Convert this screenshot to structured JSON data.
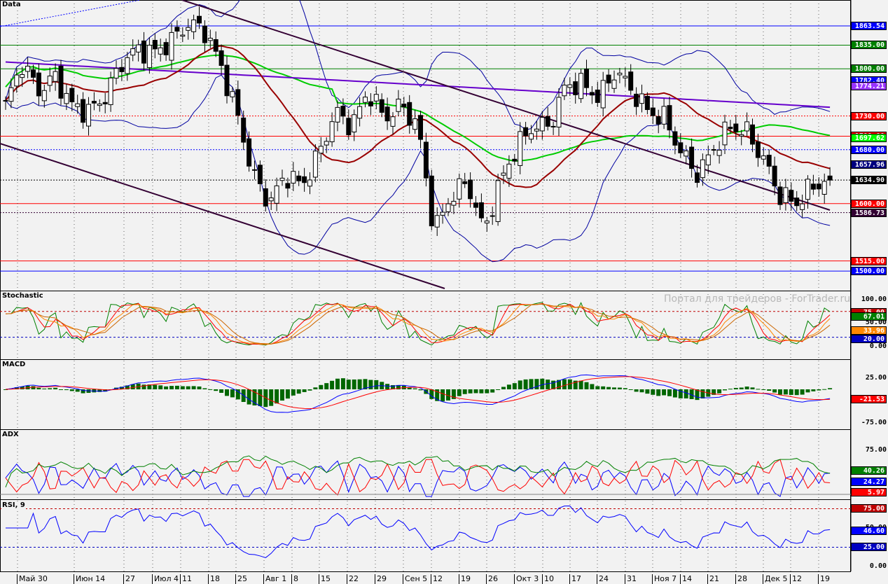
{
  "panels": {
    "main": "Data",
    "stoch": "Stochastic",
    "macd": "MACD",
    "adx": "ADX",
    "rsi": "RSI, 9"
  },
  "watermark": "Портал для трейдеров - ForTrader.ru",
  "price_tags": [
    {
      "label": "1863.54",
      "value": 1863.54,
      "color": "#0000ff",
      "line": "solid"
    },
    {
      "label": "1835.00",
      "value": 1835,
      "color": "#008000",
      "line": "solid"
    },
    {
      "label": "1800.00",
      "value": 1800,
      "color": "#008000",
      "line": "solid"
    },
    {
      "label": "1782.40",
      "value": 1782.4,
      "color": "#0000ff",
      "line": "none"
    },
    {
      "label": "1774.21",
      "value": 1774.21,
      "color": "#9933ff",
      "line": "none"
    },
    {
      "label": "1730.00",
      "value": 1730,
      "color": "#ff0000",
      "line": "dotted"
    },
    {
      "label": "1700.00",
      "value": 1700,
      "color": "#ff0000",
      "line": "solid"
    },
    {
      "label": "1697.62",
      "value": 1697.62,
      "color": "#00ff00",
      "line": "none"
    },
    {
      "label": "1680.00",
      "value": 1680,
      "color": "#0000ff",
      "line": "dotted"
    },
    {
      "label": "1657.96",
      "value": 1657.96,
      "color": "#000080",
      "line": "none"
    },
    {
      "label": "1634.90",
      "value": 1634.9,
      "color": "#000000",
      "line": "dotted"
    },
    {
      "label": "1600.00",
      "value": 1600,
      "color": "#ff0000",
      "line": "solid"
    },
    {
      "label": "1586.73",
      "value": 1586.73,
      "color": "#330033",
      "line": "dotted"
    },
    {
      "label": "1515.00",
      "value": 1515,
      "color": "#ff0000",
      "line": "solid"
    },
    {
      "label": "1500.00",
      "value": 1500,
      "color": "#0000ff",
      "line": "solid"
    }
  ],
  "indicator_axes": {
    "stoch": [
      "100.00",
      "50.00",
      "0.00"
    ],
    "macd": [
      "25.00",
      "-75.00"
    ],
    "adx": [
      "75.00"
    ],
    "rsi": [
      "50.00",
      "0.00"
    ]
  },
  "indicator_tags": {
    "stoch": [
      {
        "label": "75.00",
        "color": "#c00000"
      },
      {
        "label": "67.01",
        "color": "#008000"
      },
      {
        "label": "33.96",
        "color": "#ff8800"
      },
      {
        "label": "20.00",
        "color": "#0000c0"
      }
    ],
    "macd": [
      {
        "label": "-21.53",
        "color": "#ff0000"
      }
    ],
    "adx": [
      {
        "label": "40.26",
        "color": "#008000"
      },
      {
        "label": "24.27",
        "color": "#0000ff"
      },
      {
        "label": "5.97",
        "color": "#ff0000"
      }
    ],
    "rsi": [
      {
        "label": "75.00",
        "color": "#c00000"
      },
      {
        "label": "46.60",
        "color": "#0000ff"
      },
      {
        "label": "25.00",
        "color": "#0000c0"
      }
    ]
  },
  "dates": [
    "Май 30",
    "Июн 14",
    "27",
    "Июл 4",
    "11",
    "18",
    "25",
    "Авг 1",
    "8",
    "15",
    "22",
    "29",
    "Сен 5",
    "12",
    "19",
    "26",
    "Окт 3",
    "10",
    "17",
    "24",
    "31",
    "Ноя 7",
    "14",
    "21",
    "28",
    "Дек 5",
    "12",
    "19"
  ],
  "chart_data": {
    "type": "candlestick",
    "title": "Data",
    "ylim": [
      1475,
      1900
    ],
    "close_keypoints": [
      1746,
      1808,
      1767,
      1788,
      1746,
      1736,
      1757,
      1808,
      1829,
      1824,
      1840,
      1866,
      1860,
      1808,
      1736,
      1643,
      1601,
      1643,
      1627,
      1674,
      1736,
      1715,
      1767,
      1726,
      1746,
      1715,
      1559,
      1611,
      1632,
      1559,
      1632,
      1684,
      1715,
      1715,
      1777,
      1777,
      1757,
      1798,
      1767,
      1736,
      1726,
      1674,
      1643,
      1684,
      1715,
      1705,
      1664,
      1611,
      1601,
      1627,
      1635
    ],
    "last_close": 1634.9,
    "indicators": [
      "Stochastic",
      "MACD",
      "ADX",
      "RSI 9"
    ]
  }
}
